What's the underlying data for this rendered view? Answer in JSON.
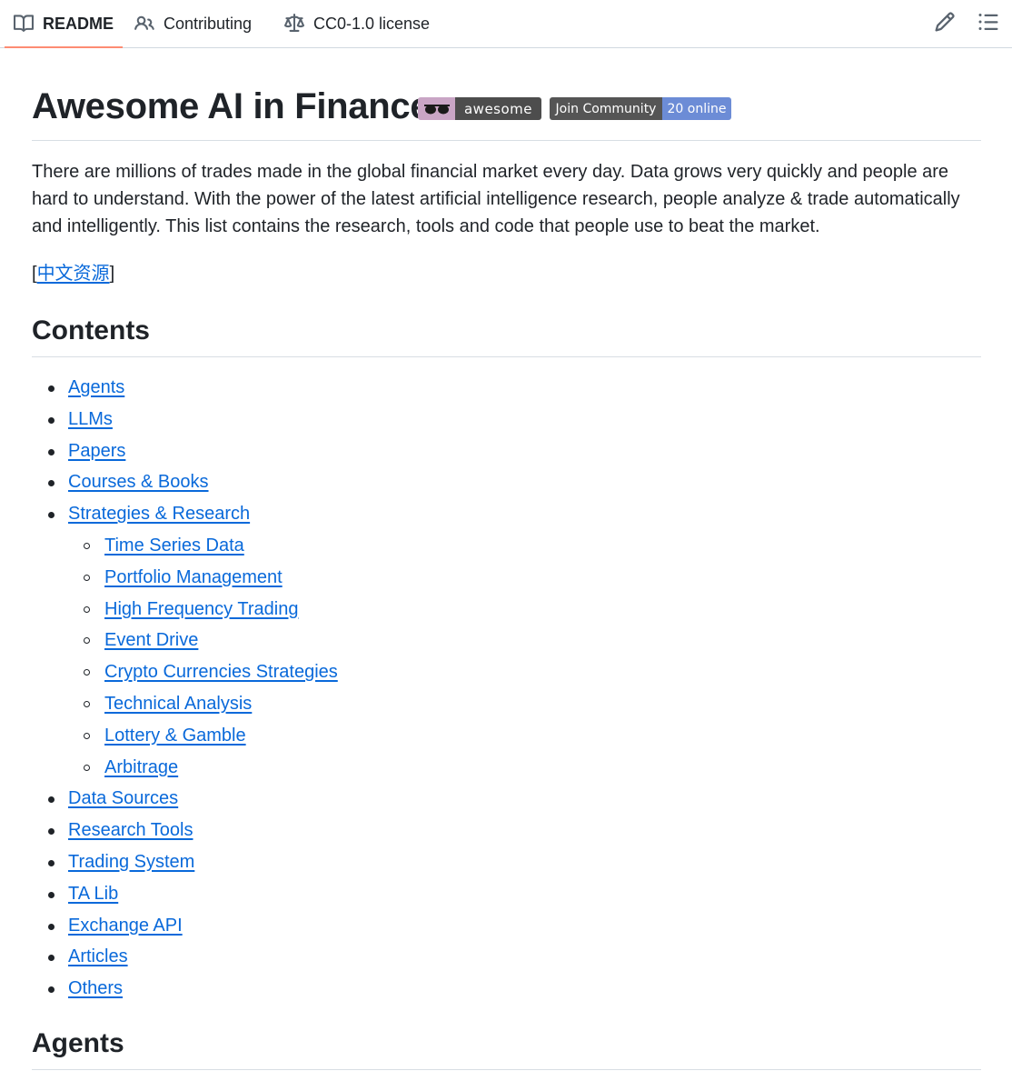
{
  "tabs": [
    {
      "label": "README",
      "icon": "book-icon",
      "active": true
    },
    {
      "label": "Contributing",
      "icon": "people-icon",
      "active": false
    },
    {
      "label": "CC0-1.0 license",
      "icon": "law-icon",
      "active": false
    }
  ],
  "toolbar": {
    "edit_icon": "pencil-icon",
    "outline_icon": "list-icon"
  },
  "readme": {
    "title": "Awesome AI in Finance",
    "badges": {
      "awesome": "awesome",
      "community_label": "Join Community",
      "community_value": "20 online"
    },
    "intro_lines": [
      "There are millions of trades made in the global financial market every day. Data grows very quickly and people are",
      "hard to understand. With the power of the latest artificial intelligence research, people analyze & trade automatically",
      "and intelligently. This list contains the research, tools and code that people use to beat the market."
    ],
    "chinese_link_open": "[",
    "chinese_link": "中文资源",
    "chinese_link_close": "]",
    "contents_heading": "Contents",
    "contents": [
      {
        "label": "Agents",
        "level": 1
      },
      {
        "label": "LLMs",
        "level": 1
      },
      {
        "label": "Papers",
        "level": 1
      },
      {
        "label": "Courses & Books",
        "level": 1
      },
      {
        "label": "Strategies & Research",
        "level": 1
      },
      {
        "label": "Time Series Data",
        "level": 2
      },
      {
        "label": "Portfolio Management",
        "level": 2
      },
      {
        "label": "High Frequency Trading",
        "level": 2
      },
      {
        "label": "Event Drive",
        "level": 2
      },
      {
        "label": "Crypto Currencies Strategies",
        "level": 2
      },
      {
        "label": "Technical Analysis",
        "level": 2
      },
      {
        "label": "Lottery & Gamble",
        "level": 2
      },
      {
        "label": "Arbitrage",
        "level": 2
      },
      {
        "label": "Data Sources",
        "level": 1
      },
      {
        "label": "Research Tools",
        "level": 1
      },
      {
        "label": "Trading System",
        "level": 1
      },
      {
        "label": "TA Lib",
        "level": 1
      },
      {
        "label": "Exchange API",
        "level": 1
      },
      {
        "label": "Articles",
        "level": 1
      },
      {
        "label": "Others",
        "level": 1
      }
    ],
    "agents_heading": "Agents"
  },
  "colors": {
    "link": "#0969da",
    "active_tab_underline": "#fd8c73",
    "text": "#1f2328"
  }
}
